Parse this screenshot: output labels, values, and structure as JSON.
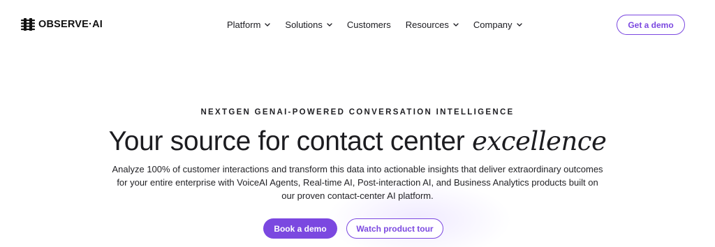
{
  "header": {
    "logo_text": "OBSERVE·AI",
    "nav": [
      {
        "label": "Platform",
        "has_dropdown": true
      },
      {
        "label": "Solutions",
        "has_dropdown": true
      },
      {
        "label": "Customers",
        "has_dropdown": false
      },
      {
        "label": "Resources",
        "has_dropdown": true
      },
      {
        "label": "Company",
        "has_dropdown": true
      }
    ],
    "cta_label": "Get a demo"
  },
  "hero": {
    "eyebrow": "NEXTGEN GENAI-POWERED CONVERSATION INTELLIGENCE",
    "headline_plain": "Your source for contact center",
    "headline_emphasis": "excellence",
    "description": "Analyze 100% of customer interactions and transform this data into actionable insights that deliver extraordinary outcomes for your entire enterprise with VoiceAI Agents, Real-time AI, Post-interaction AI, and Business Analytics products built on our proven contact-center AI platform.",
    "primary_button": "Book a demo",
    "secondary_button": "Watch product tour"
  },
  "colors": {
    "accent": "#7b48e0",
    "text": "#1c1c20",
    "background": "#ffffff"
  },
  "icons": {
    "logo_mark": "observe-ai-logo-icon",
    "dropdown": "chevron-down-icon"
  }
}
